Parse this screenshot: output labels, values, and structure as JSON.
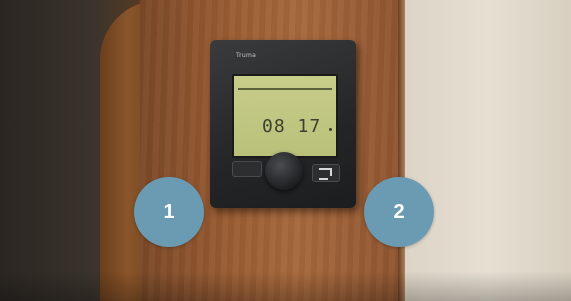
{
  "device": {
    "brand": "Truma",
    "display_time": "08 17"
  },
  "markers": [
    {
      "label": "1"
    },
    {
      "label": "2"
    }
  ]
}
